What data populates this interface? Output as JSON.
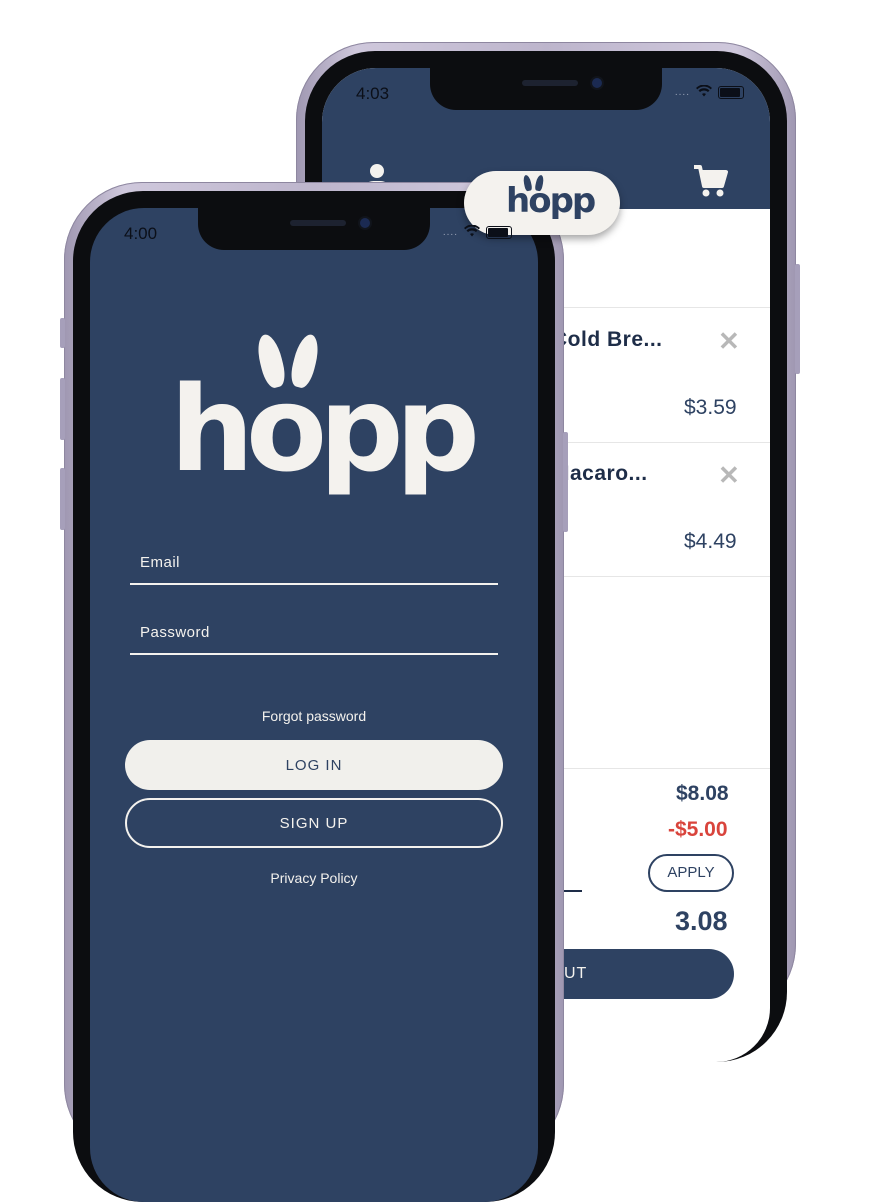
{
  "colors": {
    "navy": "#2e4262",
    "cream": "#f4f2ee",
    "discount_red": "#d9443c",
    "frame_lilac": "#cfc8dc"
  },
  "back_phone": {
    "status": {
      "time": "4:03",
      "signal_dots": "....",
      "wifi_icon": "wifi-icon",
      "battery_icon": "battery-icon"
    },
    "header": {
      "logo": "hopp",
      "profile_icon": "user-icon",
      "cart_icon": "cart-icon"
    },
    "cart_items": [
      {
        "name": "Cold Bre...",
        "price": "$3.59",
        "remove": "✕"
      },
      {
        "name": "Macaro...",
        "price": "$4.49",
        "remove": "✕"
      }
    ],
    "summary": {
      "subtotal": "$8.08",
      "discount": "-$5.00",
      "apply_label": "APPLY",
      "total": "3.08"
    },
    "checkout_label": "UT"
  },
  "front_phone": {
    "status": {
      "time": "4:00",
      "signal_dots": "....",
      "wifi_icon": "wifi-icon",
      "battery_icon": "battery-icon"
    },
    "logo": "hopp",
    "email_placeholder": "Email",
    "password_placeholder": "Password",
    "forgot_label": "Forgot password",
    "login_label": "LOG IN",
    "signup_label": "SIGN UP",
    "privacy_label": "Privacy Policy"
  }
}
